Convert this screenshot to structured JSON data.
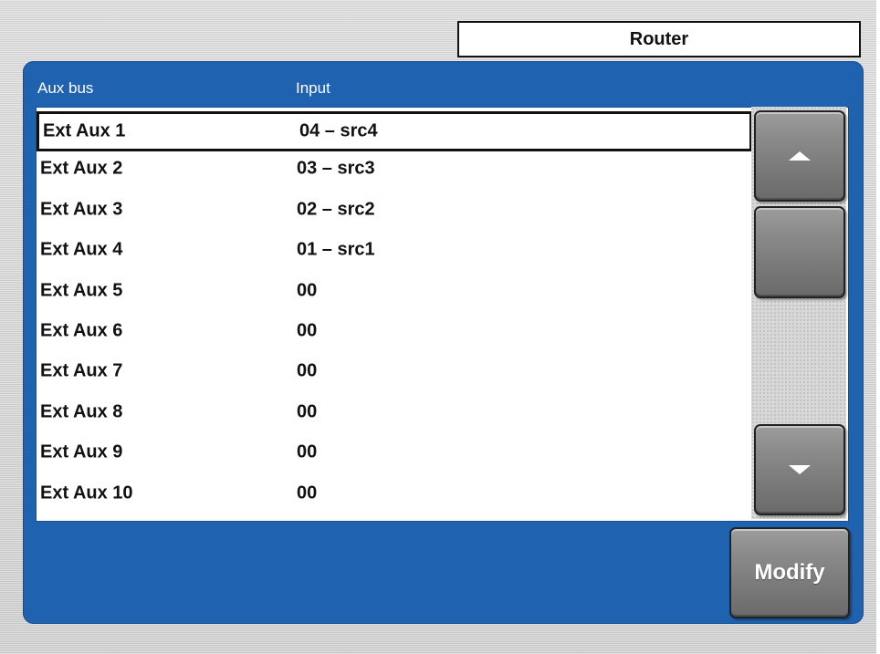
{
  "header": {
    "title": "Router"
  },
  "table": {
    "columns": [
      "Aux bus",
      "Input"
    ],
    "rows": [
      {
        "aux_bus": "Ext Aux 1",
        "input": "04 – src4",
        "selected": true
      },
      {
        "aux_bus": "Ext Aux 2",
        "input": "03 – src3",
        "selected": false
      },
      {
        "aux_bus": "Ext Aux 3",
        "input": "02 – src2",
        "selected": false
      },
      {
        "aux_bus": "Ext Aux 4",
        "input": "01 – src1",
        "selected": false
      },
      {
        "aux_bus": "Ext Aux 5",
        "input": "00",
        "selected": false
      },
      {
        "aux_bus": "Ext Aux 6",
        "input": "00",
        "selected": false
      },
      {
        "aux_bus": "Ext Aux 7",
        "input": "00",
        "selected": false
      },
      {
        "aux_bus": "Ext Aux 8",
        "input": "00",
        "selected": false
      },
      {
        "aux_bus": "Ext Aux 9",
        "input": "00",
        "selected": false
      },
      {
        "aux_bus": "Ext Aux 10",
        "input": "00",
        "selected": false
      }
    ]
  },
  "scrollbar": {
    "up_icon": "arrow-up-icon",
    "down_icon": "arrow-down-icon"
  },
  "actions": {
    "modify_label": "Modify"
  },
  "colors": {
    "panel_blue": "#1f63b0",
    "background_gray": "#d6d6d6",
    "button_gray": "#7f7f7f"
  }
}
